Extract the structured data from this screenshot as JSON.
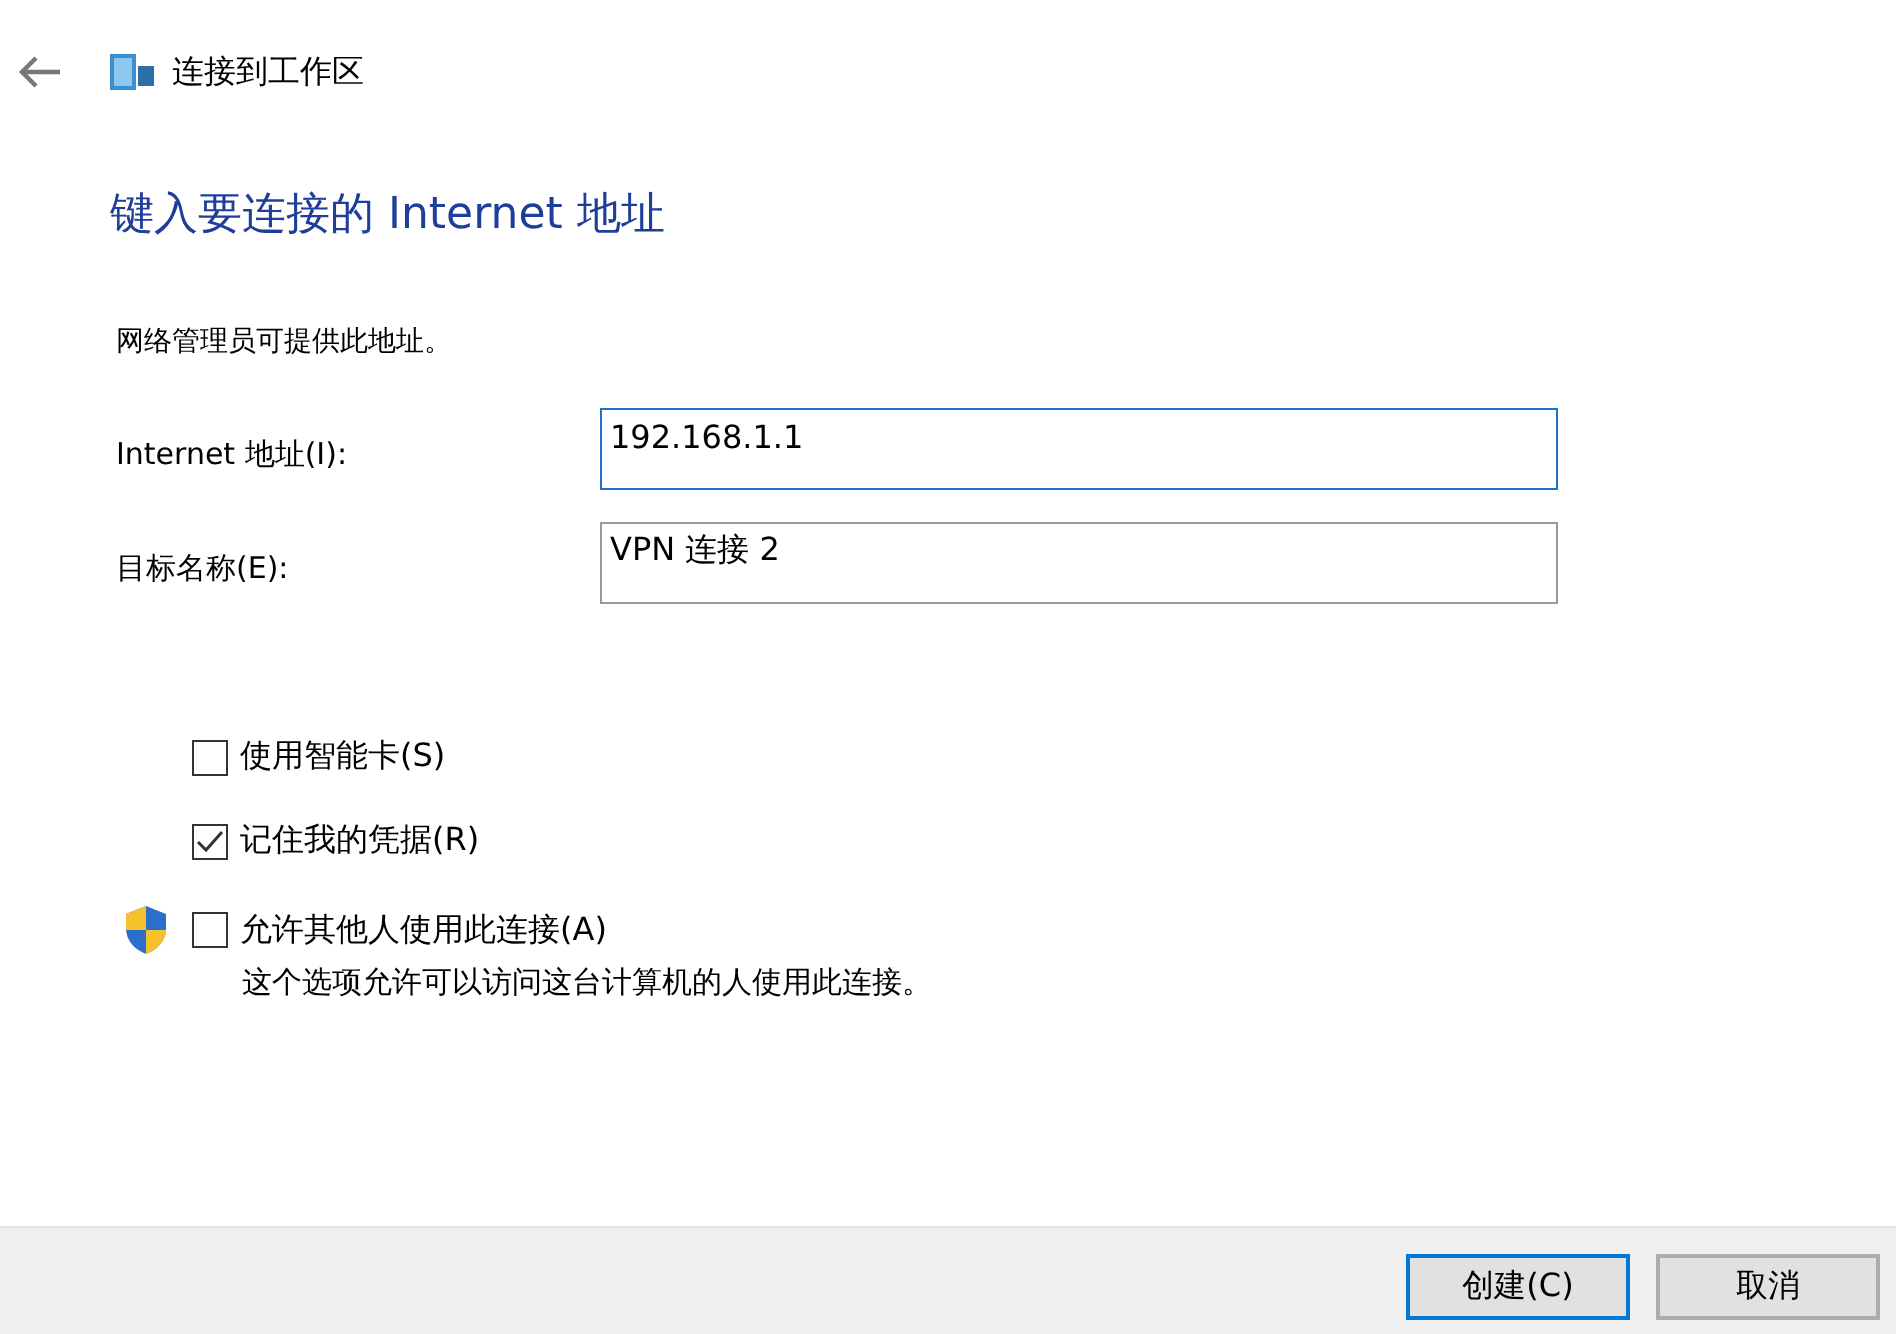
{
  "window": {
    "title": "连接到工作区"
  },
  "heading": "键入要连接的 Internet 地址",
  "description": "网络管理员可提供此地址。",
  "fields": [
    {
      "label": "Internet 地址(I):",
      "value": "192.168.1.1",
      "focused": true
    },
    {
      "label": "目标名称(E):",
      "value": "VPN 连接 2",
      "focused": false
    }
  ],
  "options": [
    {
      "label": "使用智能卡(S)",
      "checked": false,
      "shield": false
    },
    {
      "label": "记住我的凭据(R)",
      "checked": true,
      "shield": false
    },
    {
      "label": "允许其他人使用此连接(A)",
      "checked": false,
      "shield": true,
      "note": "这个选项允许可以访问这台计算机的人使用此连接。"
    }
  ],
  "buttons": [
    {
      "label": "创建(C)",
      "default": true
    },
    {
      "label": "取消",
      "default": false
    }
  ]
}
